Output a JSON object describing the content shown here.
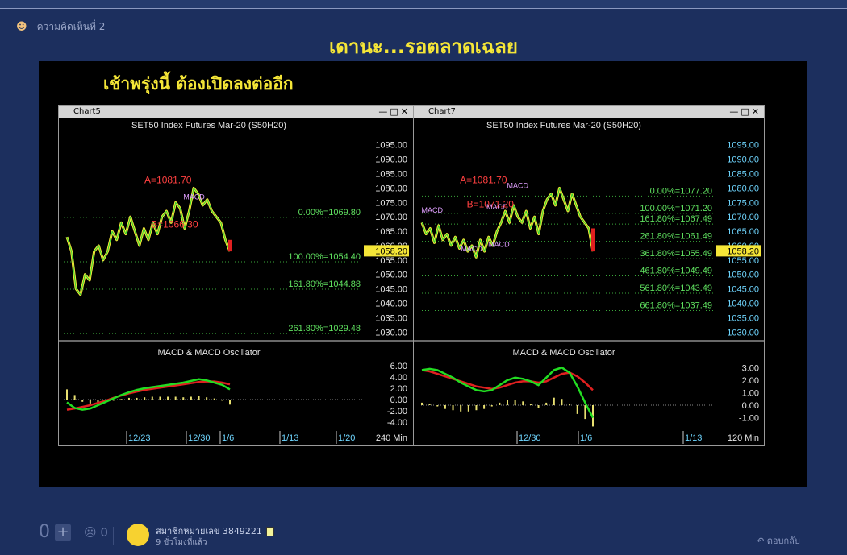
{
  "comment": {
    "label": "ความคิดเห็นที่ 2",
    "avatar_icon": "user-icon"
  },
  "post": {
    "title": "เดานะ...รอตลาดเฉลย"
  },
  "image": {
    "caption": "เช้าพรุ่งนี้ ต้องเปิดลงต่ออีก"
  },
  "footer": {
    "score": "0",
    "neg_score": "0",
    "member": "สมาชิกหมายเลข 3849221",
    "time": "9 ชั่วโมงที่แล้ว",
    "reply": "ตอบกลับ",
    "plus_icon": "plus-icon",
    "reply_icon": "reply-icon"
  },
  "chart_data": [
    {
      "type": "line",
      "window": "Chart5",
      "title": "SET50 Index Futures Mar-20 (S50H20)",
      "y_ticks": [
        "1095.00",
        "1090.00",
        "1085.00",
        "1080.00",
        "1075.00",
        "1070.00",
        "1065.00",
        "1060.00",
        "1055.00",
        "1050.00",
        "1045.00",
        "1040.00",
        "1035.00",
        "1030.00"
      ],
      "ylim": [
        1027,
        1098
      ],
      "last_price": "1058.20",
      "fib_levels": [
        {
          "label": "0.00%=1069.80",
          "value": 1069.8
        },
        {
          "label": "100.00%=1054.40",
          "value": 1054.4
        },
        {
          "label": "161.80%=1044.88",
          "value": 1044.88
        },
        {
          "label": "261.80%=1029.48",
          "value": 1029.48
        }
      ],
      "annotations": [
        {
          "label": "A=1081.70",
          "x": 0.62,
          "value": 1081.7
        },
        {
          "label": "B=1066.30",
          "x": 0.66,
          "value": 1066.3
        },
        {
          "label": "MACD",
          "x": 0.78,
          "value": 1076
        }
      ],
      "price_series": [
        1063,
        1058,
        1045,
        1043,
        1050,
        1048,
        1058,
        1060,
        1055,
        1058,
        1065,
        1062,
        1068,
        1064,
        1070,
        1065,
        1060,
        1066,
        1062,
        1068,
        1064,
        1070,
        1072,
        1068,
        1075,
        1073,
        1066,
        1072,
        1080,
        1078,
        1074,
        1076,
        1072,
        1070,
        1068,
        1062,
        1058
      ],
      "indicator": {
        "title": "MACD & MACD Oscillator",
        "y_ticks": [
          "6.00",
          "4.00",
          "2.00",
          "0.00",
          "-2.00",
          "-4.00"
        ],
        "ylim": [
          -5,
          7
        ],
        "macd": [
          -0.5,
          -1.5,
          -1.8,
          -1.6,
          -1.0,
          -0.4,
          0.2,
          0.8,
          1.3,
          1.7,
          2.0,
          2.2,
          2.4,
          2.6,
          2.8,
          3.0,
          3.3,
          3.6,
          3.4,
          3.0,
          2.6,
          1.8
        ],
        "signal": [
          -1.8,
          -1.6,
          -1.3,
          -1.0,
          -0.6,
          -0.2,
          0.3,
          0.7,
          1.1,
          1.4,
          1.7,
          1.9,
          2.1,
          2.3,
          2.5,
          2.7,
          2.9,
          3.1,
          3.2,
          3.2,
          3.0,
          2.7
        ],
        "oscillator": [
          1.8,
          0.8,
          -0.4,
          -0.7,
          -0.6,
          -0.4,
          -0.2,
          0.1,
          0.3,
          0.3,
          0.4,
          0.5,
          0.5,
          0.5,
          0.5,
          0.4,
          0.5,
          0.6,
          0.4,
          0.2,
          -0.2,
          -0.9
        ]
      },
      "x_ticks": [
        "12/23",
        "12/30",
        "1/6",
        "1/13",
        "1/20"
      ],
      "interval": "240 Min"
    },
    {
      "type": "line",
      "window": "Chart7",
      "title": "SET50 Index Futures Mar-20 (S50H20)",
      "y_ticks": [
        "1095.00",
        "1090.00",
        "1085.00",
        "1080.00",
        "1075.00",
        "1070.00",
        "1065.00",
        "1060.00",
        "1055.00",
        "1050.00",
        "1045.00",
        "1040.00",
        "1035.00",
        "1030.00"
      ],
      "ylim": [
        1027,
        1098
      ],
      "last_price": "1058.20",
      "fib_levels": [
        {
          "label": "0.00%=1077.20",
          "value": 1077.2
        },
        {
          "label": "100.00%=1071.20",
          "value": 1071.2
        },
        {
          "label": "161.80%=1067.49",
          "value": 1067.49
        },
        {
          "label": "261.80%=1061.49",
          "value": 1061.49
        },
        {
          "label": "361.80%=1055.49",
          "value": 1055.49
        },
        {
          "label": "461.80%=1049.49",
          "value": 1049.49
        },
        {
          "label": "561.80%=1043.49",
          "value": 1043.49
        },
        {
          "label": "661.80%=1037.49",
          "value": 1037.49
        }
      ],
      "annotations": [
        {
          "label": "A=1081.70",
          "x": 0.36,
          "value": 1081.7
        },
        {
          "label": "B=1071.20",
          "x": 0.4,
          "value": 1073.2
        },
        {
          "label": "MACD",
          "x": 0.06,
          "value": 1071.5
        },
        {
          "label": "MACD",
          "x": 0.29,
          "value": 1058
        },
        {
          "label": "MACD",
          "x": 0.44,
          "value": 1072.5
        },
        {
          "label": "MACD",
          "x": 0.45,
          "value": 1059.5
        },
        {
          "label": "MACD",
          "x": 0.56,
          "value": 1080
        }
      ],
      "price_series": [
        1068,
        1064,
        1066,
        1061,
        1067,
        1062,
        1064,
        1060,
        1063,
        1059,
        1062,
        1058,
        1060,
        1056,
        1062,
        1058,
        1063,
        1060,
        1065,
        1068,
        1072,
        1068,
        1074,
        1070,
        1068,
        1072,
        1066,
        1070,
        1064,
        1072,
        1076,
        1078,
        1074,
        1080,
        1076,
        1072,
        1078,
        1074,
        1070,
        1068,
        1066,
        1058
      ],
      "indicator": {
        "title": "MACD & MACD Oscillator",
        "y_ticks": [
          "3.00",
          "2.00",
          "1.00",
          "0.00",
          "-1.00"
        ],
        "ylim": [
          -1.8,
          3.6
        ],
        "macd": [
          2.8,
          2.9,
          2.8,
          2.5,
          2.2,
          1.8,
          1.5,
          1.2,
          1.1,
          1.2,
          1.6,
          2.0,
          2.2,
          2.1,
          1.9,
          1.6,
          2.2,
          2.8,
          3.0,
          2.6,
          1.5,
          0.2,
          -1.0
        ],
        "signal": [
          2.8,
          2.7,
          2.5,
          2.3,
          2.1,
          1.9,
          1.7,
          1.5,
          1.4,
          1.3,
          1.4,
          1.6,
          1.8,
          1.9,
          1.9,
          1.8,
          1.9,
          2.2,
          2.5,
          2.6,
          2.3,
          1.8,
          1.2
        ],
        "oscillator": [
          0.2,
          0.1,
          -0.1,
          -0.3,
          -0.4,
          -0.5,
          -0.5,
          -0.4,
          -0.3,
          -0.1,
          0.2,
          0.4,
          0.4,
          0.3,
          0.1,
          -0.2,
          0.2,
          0.6,
          0.5,
          0.1,
          -0.7,
          -1.1,
          -1.7
        ]
      },
      "x_ticks": [
        "12/30",
        "1/6",
        "1/13"
      ],
      "interval": "120 Min"
    }
  ]
}
